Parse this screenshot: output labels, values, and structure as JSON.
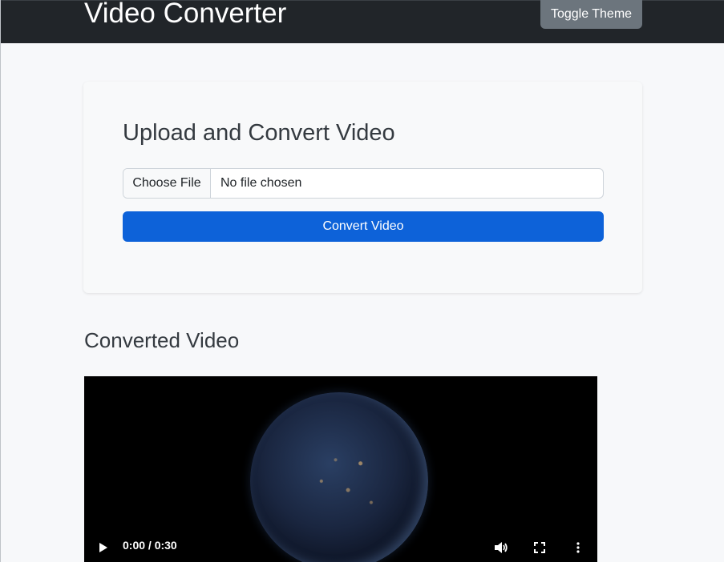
{
  "navbar": {
    "brand": "Video Converter",
    "toggle_theme_label": "Toggle Theme"
  },
  "upload_card": {
    "title": "Upload and Convert Video",
    "choose_file_label": "Choose File",
    "file_status": "No file chosen",
    "convert_button_label": "Convert Video"
  },
  "converted": {
    "title": "Converted Video"
  },
  "video_player": {
    "time_display": "0:00 / 0:30",
    "icons": [
      "play-icon",
      "volume-icon",
      "fullscreen-icon",
      "more-options-icon"
    ]
  },
  "colors": {
    "navbar_bg": "#212529",
    "toggle_btn_bg": "#6c757d",
    "primary_btn_bg": "#0d62d9",
    "page_bg": "#f7f8fa"
  }
}
